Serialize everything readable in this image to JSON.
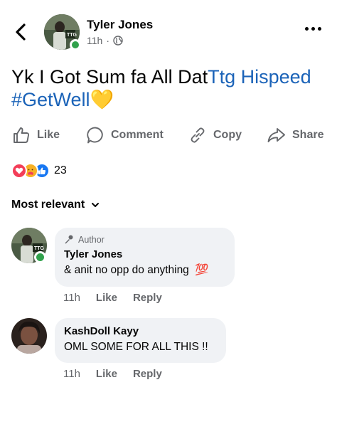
{
  "post": {
    "author": "Tyler Jones",
    "time": "11h",
    "separator": "·",
    "text_plain": "Yk I Got Sum fa All Dat",
    "text_link": "Ttg Hispeed",
    "text_hashtag": "#GetWell",
    "emoji": "💛"
  },
  "actions": {
    "like": "Like",
    "comment": "Comment",
    "copy": "Copy",
    "share": "Share"
  },
  "reactions": {
    "types": [
      "love",
      "care",
      "like"
    ],
    "count": "23"
  },
  "sort": {
    "label": "Most relevant"
  },
  "comments": [
    {
      "badge": "Author",
      "name": "Tyler Jones",
      "text": "& anit no opp do anything",
      "emoji": "💯",
      "time": "11h",
      "like": "Like",
      "reply": "Reply"
    },
    {
      "name": "KashDoll Kayy",
      "text": "OML SOME FOR ALL THIS !!",
      "time": "11h",
      "like": "Like",
      "reply": "Reply"
    }
  ],
  "colors": {
    "link": "#1b63b8",
    "online": "#31a24c",
    "secondary_text": "#65676b",
    "bubble": "#f0f2f5",
    "love": "#f33e58",
    "like": "#1877f2",
    "care": "#f7b125"
  }
}
